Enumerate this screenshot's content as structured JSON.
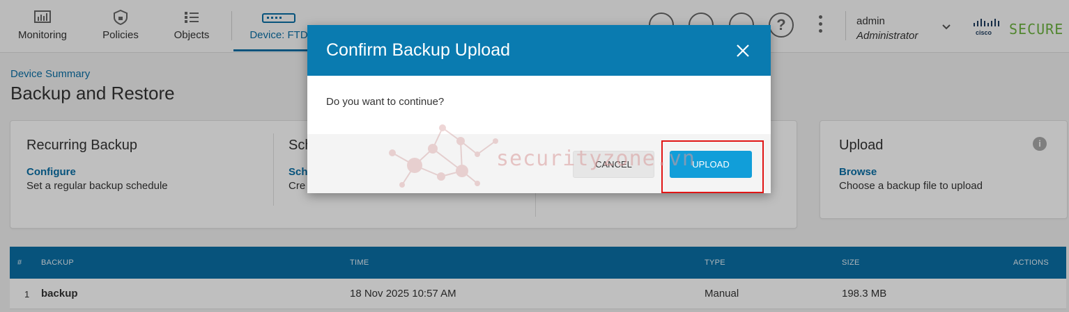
{
  "nav": {
    "items": [
      {
        "label": "Monitoring",
        "icon": "monitoring-icon"
      },
      {
        "label": "Policies",
        "icon": "policies-icon"
      },
      {
        "label": "Objects",
        "icon": "objects-icon"
      },
      {
        "label": "Device: FTD",
        "icon": "device-icon",
        "active": true
      }
    ],
    "right_icons": [
      "deploy-icon",
      "download-icon",
      "tasks-icon",
      "help-icon",
      "more-icon"
    ],
    "help_glyph": "?",
    "user": {
      "name": "admin",
      "role": "Administrator"
    },
    "brand": "SECURE"
  },
  "page": {
    "breadcrumb": "Device Summary",
    "title": "Backup and Restore"
  },
  "cards": {
    "recurring": {
      "title": "Recurring Backup",
      "link": "Configure",
      "desc": "Set a regular backup schedule"
    },
    "scheduled": {
      "title": "Sch",
      "link": "Sch",
      "desc": "Cre"
    },
    "upload": {
      "title": "Upload",
      "link": "Browse",
      "desc": "Choose a backup file to upload",
      "info_glyph": "i"
    }
  },
  "table": {
    "headers": [
      "#",
      "BACKUP",
      "TIME",
      "TYPE",
      "SIZE",
      "ACTIONS"
    ],
    "rows": [
      {
        "num": "1",
        "backup": "backup",
        "time": "18 Nov 2025 10:57 AM",
        "type": "Manual",
        "size": "198.3 MB"
      }
    ]
  },
  "modal": {
    "title": "Confirm Backup Upload",
    "body": "Do you want to continue?",
    "cancel_label": "CANCEL",
    "upload_label": "UPLOAD"
  },
  "watermark": "securityzone.vn",
  "colors": {
    "header_blue": "#0a7bb0",
    "upload_button": "#119ed9",
    "highlight": "#e01515",
    "brand_green": "#6cb33f"
  }
}
